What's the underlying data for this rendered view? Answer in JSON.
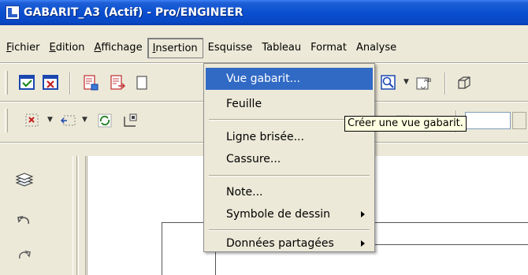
{
  "window": {
    "title": "GABARIT_A3 (Actif) - Pro/ENGINEER"
  },
  "menubar": {
    "items": [
      {
        "label": "Fichier",
        "accel": "F"
      },
      {
        "label": "Edition",
        "accel": "E"
      },
      {
        "label": "Affichage",
        "accel": "A"
      },
      {
        "label": "Insertion",
        "accel": "I"
      },
      {
        "label": "Esquisse",
        "accel": "q"
      },
      {
        "label": "Tableau",
        "accel": "b"
      },
      {
        "label": "Format",
        "accel": "t"
      },
      {
        "label": "Analyse",
        "accel": "y"
      }
    ]
  },
  "insertion_menu": {
    "items": [
      {
        "label": "Vue gabarit...",
        "highlighted": true
      },
      {
        "label": "Feuille"
      },
      {
        "label": "Ligne brisée..."
      },
      {
        "label": "Cassure..."
      },
      {
        "label": "Note..."
      },
      {
        "label": "Symbole de dessin",
        "submenu": true
      },
      {
        "label": "Données partagées",
        "submenu": true
      }
    ]
  },
  "tooltip": {
    "text": "Créer une vue gabarit."
  },
  "colors": {
    "titlebar": "#0a4fd0",
    "highlight": "#316ac5",
    "tooltip_bg": "#ffffe1",
    "chrome": "#ece9d8"
  },
  "icons": {
    "toolbar1": [
      "repaint-icon",
      "close-window-icon",
      "sheet-setup-icon",
      "sheet-move-icon",
      "zoom-icon",
      "text-style-icon",
      "3d-view-icon"
    ],
    "toolbar2": [
      "select-region-icon",
      "select-area-icon",
      "regenerate-icon",
      "layout-icon",
      "table-icon"
    ],
    "leftpanel": [
      "layers-icon",
      "undo-icon",
      "redo-icon"
    ]
  }
}
